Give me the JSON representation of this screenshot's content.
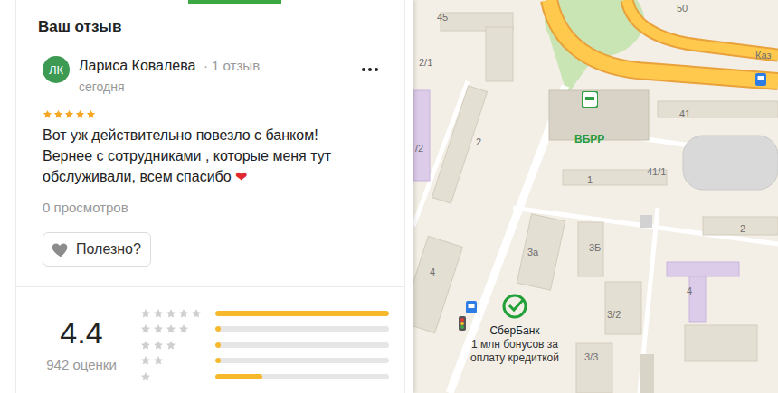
{
  "tab_indicator": {
    "selected": true
  },
  "panel": {
    "title": "Ваш отзыв"
  },
  "review": {
    "initials": "ЛК",
    "author": "Лариса Ковалева",
    "author_reviews": "· 1 отзыв",
    "date": "сегодня",
    "stars": 5,
    "text_lines": [
      "Вот уж действительно повезло с банком!",
      "Вернее с сотрудниками , которые меня тут",
      "обслуживали, всем спасибо"
    ],
    "emoji": "❤",
    "views": "0 просмотров",
    "useful_button": {
      "label": "Полезно?",
      "liked": false
    }
  },
  "rating": {
    "value": "4.4",
    "count": "942 оценки",
    "distribution": [
      {
        "stars": 5,
        "level": 1.0
      },
      {
        "stars": 4,
        "level": 0.03
      },
      {
        "stars": 3,
        "level": 0.03
      },
      {
        "stars": 2,
        "level": 0.03
      },
      {
        "stars": 1,
        "level": 0.27
      }
    ]
  },
  "map": {
    "labels": [
      {
        "text": "45"
      },
      {
        "text": "50"
      },
      {
        "text": "2/1"
      },
      {
        "text": "/2"
      },
      {
        "text": "2"
      },
      {
        "text": "41"
      },
      {
        "text": "41/1"
      },
      {
        "text": "1"
      },
      {
        "text": "2"
      },
      {
        "text": "3а"
      },
      {
        "text": "3Б"
      },
      {
        "text": "4"
      },
      {
        "text": "4"
      },
      {
        "text": "3/2"
      },
      {
        "text": "3/3"
      },
      {
        "text": "Каз"
      }
    ],
    "pois": [
      {
        "name": "ВБРР",
        "promo": []
      },
      {
        "name": "СберБанк",
        "promo": [
          "1 млн бонусов за",
          "оплату кредиткой"
        ]
      }
    ]
  }
}
